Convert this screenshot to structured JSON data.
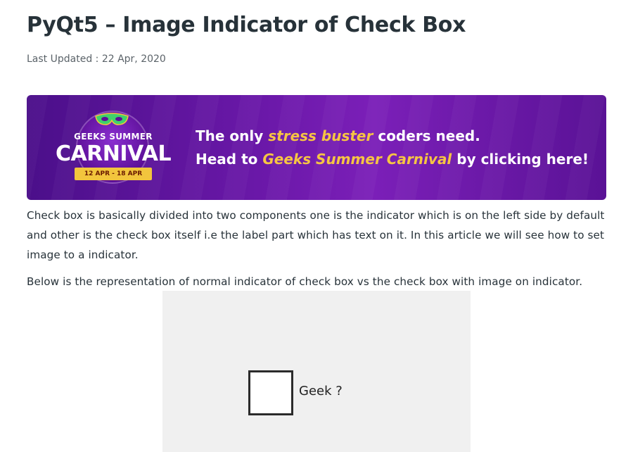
{
  "article": {
    "title": "PyQt5 – Image Indicator of Check Box",
    "last_updated": "Last Updated : 22 Apr, 2020"
  },
  "banner": {
    "logo_geeks": "GEEKS SUMMER",
    "logo_carnival": "CARNIVAL",
    "logo_dates": "12 APR - 18 APR",
    "line1_pre": "The only ",
    "line1_highlight": "stress buster",
    "line1_post": " coders need.",
    "line2_pre": "Head to ",
    "line2_highlight": "Geeks Summer Carnival",
    "line2_post": " by clicking here!",
    "highlight_color": "#f6c543",
    "background_color": "#6a18a8"
  },
  "content": {
    "paragraph1": "Check box is basically divided into two components one is the indicator which is on the left side by default and other is the check box itself i.e the label part which has text on it. In this article we will see how to set image to a indicator.",
    "paragraph2": "Below is the representation of normal indicator of check box vs the check box with image on indicator."
  },
  "demo": {
    "checkbox_label": "Geek ?",
    "checked": false
  }
}
